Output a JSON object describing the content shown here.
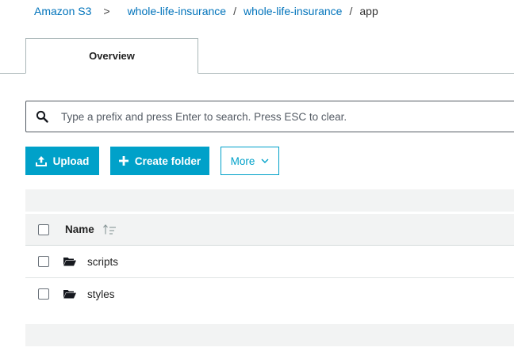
{
  "breadcrumb": {
    "items": [
      {
        "label": "Amazon S3"
      },
      {
        "label": "whole-life-insurance"
      },
      {
        "label": "whole-life-insurance"
      }
    ],
    "separators": [
      ">",
      "/",
      "/"
    ],
    "current": "app"
  },
  "tabs": [
    {
      "label": "Overview",
      "active": true
    }
  ],
  "search": {
    "value": "",
    "placeholder": "Type a prefix and press Enter to search. Press ESC to clear.",
    "icon": "search-icon"
  },
  "actions": {
    "upload_label": "Upload",
    "upload_icon": "upload-icon",
    "create_folder_label": "Create folder",
    "create_folder_icon": "plus-icon",
    "more_label": "More",
    "more_icon": "chevron-down-icon"
  },
  "table": {
    "columns": [
      {
        "label": "Name",
        "sort_icon": "sort-ascending-icon"
      }
    ],
    "rows": [
      {
        "name": "scripts",
        "type": "folder",
        "selected": false
      },
      {
        "name": "styles",
        "type": "folder",
        "selected": false
      }
    ]
  },
  "colors": {
    "link": "#0073bb",
    "primary": "#00a1c9",
    "border": "#aab7b8",
    "table_header_bg": "#f2f3f3"
  }
}
